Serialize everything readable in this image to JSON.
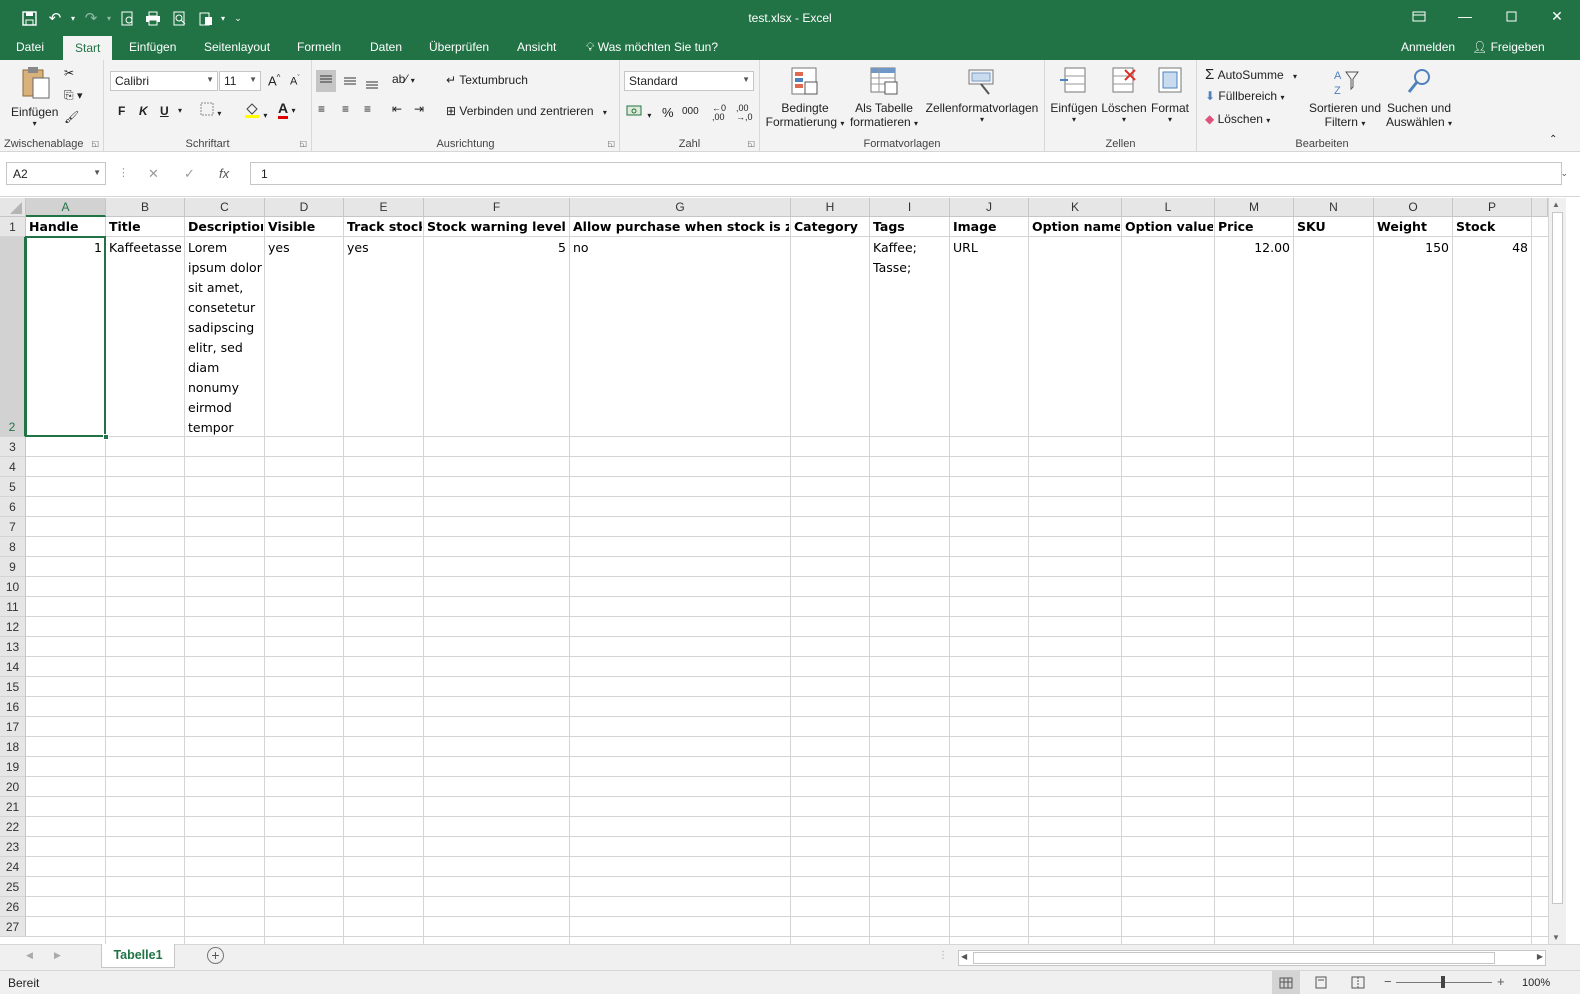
{
  "app": {
    "window_title": "test.xlsx - Excel",
    "tabs": [
      "Datei",
      "Start",
      "Einfügen",
      "Seitenlayout",
      "Formeln",
      "Daten",
      "Überprüfen",
      "Ansicht"
    ],
    "tell_me": "Was möchten Sie tun?",
    "sign_in": "Anmelden",
    "share": "Freigeben"
  },
  "ribbon": {
    "clipboard": {
      "paste": "Einfügen",
      "label": "Zwischenablage"
    },
    "font": {
      "name": "Calibri",
      "size": "11",
      "bold": "F",
      "italic": "K",
      "underline": "U",
      "label": "Schriftart"
    },
    "alignment": {
      "wrap": "Textumbruch",
      "merge": "Verbinden und zentrieren",
      "label": "Ausrichtung"
    },
    "number": {
      "format": "Standard",
      "percent": "%",
      "thousands": "000",
      "label": "Zahl"
    },
    "styles": {
      "conditional_1": "Bedingte",
      "conditional_2": "Formatierung",
      "table_1": "Als Tabelle",
      "table_2": "formatieren",
      "cell_styles": "Zellenformatvorlagen",
      "label": "Formatvorlagen"
    },
    "cells": {
      "insert": "Einfügen",
      "delete": "Löschen",
      "format": "Format",
      "label": "Zellen"
    },
    "editing": {
      "autosum": "AutoSumme",
      "fill": "Füllbereich",
      "clear": "Löschen",
      "sort_1": "Sortieren und",
      "sort_2": "Filtern",
      "find_1": "Suchen und",
      "find_2": "Auswählen",
      "label": "Bearbeiten"
    }
  },
  "formula_bar": {
    "name_box": "A2",
    "value": "1",
    "fx": "fx"
  },
  "sheet": {
    "columns": [
      "A",
      "B",
      "C",
      "D",
      "E",
      "F",
      "G",
      "H",
      "I",
      "J",
      "K",
      "L",
      "M",
      "N",
      "O",
      "P"
    ],
    "rows": [
      "1",
      "2",
      "3",
      "4",
      "5",
      "6",
      "7",
      "8",
      "9",
      "10",
      "11",
      "12",
      "13",
      "14",
      "15",
      "16",
      "17",
      "18",
      "19",
      "20",
      "21",
      "22",
      "23",
      "24",
      "25",
      "26",
      "27"
    ],
    "headers": [
      "Handle",
      "Title",
      "Description",
      "Visible",
      "Track stock",
      "Stock warning level",
      "Allow purchase when stock is zero",
      "Category",
      "Tags",
      "Image",
      "Option names",
      "Option values",
      "Price",
      "SKU",
      "Weight",
      "Stock"
    ],
    "row2": {
      "handle": "1",
      "title": "Kaffeetasse",
      "description_lines": [
        "Lorem",
        "ipsum dolor",
        "sit amet,",
        "consetetur",
        "sadipscing",
        "elitr, sed",
        "diam",
        "nonumy",
        "eirmod",
        "tempor"
      ],
      "visible": "yes",
      "track_stock": "yes",
      "stock_warning": "5",
      "allow_purchase": "no",
      "tags_lines": [
        "Kaffee;",
        "Tasse;"
      ],
      "image": "URL",
      "price": "12.00",
      "weight": "150",
      "stock": "48"
    }
  },
  "sheet_tabs": [
    "Tabelle1"
  ],
  "status": {
    "ready": "Bereit",
    "zoom": "100%"
  }
}
